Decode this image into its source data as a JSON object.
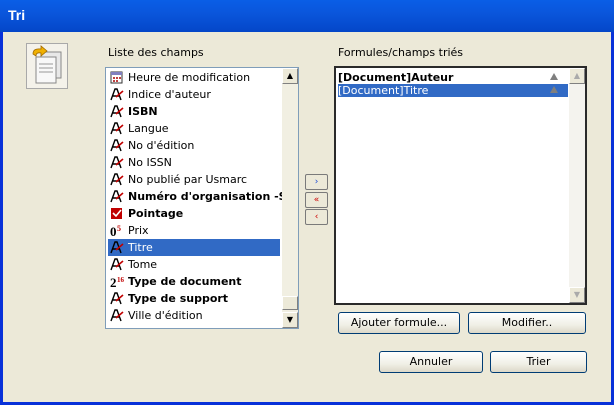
{
  "window": {
    "title": "Tri"
  },
  "fields_list": {
    "label": "Liste des champs",
    "items": [
      {
        "label": "Heure de modification",
        "bold": false,
        "icon": "calendar-icon"
      },
      {
        "label": "Indice d'auteur",
        "bold": false,
        "icon": "text-field-icon"
      },
      {
        "label": "ISBN",
        "bold": true,
        "icon": "text-field-icon"
      },
      {
        "label": "Langue",
        "bold": false,
        "icon": "text-field-icon"
      },
      {
        "label": "No d'édition",
        "bold": false,
        "icon": "text-field-icon"
      },
      {
        "label": "No ISSN",
        "bold": false,
        "icon": "text-field-icon"
      },
      {
        "label": "No publié par Usmarc",
        "bold": false,
        "icon": "text-field-icon"
      },
      {
        "label": "Numéro d'organisation -SD",
        "bold": true,
        "icon": "text-field-icon"
      },
      {
        "label": "Pointage",
        "bold": true,
        "icon": "checkbox-field-icon"
      },
      {
        "label": "Prix",
        "bold": false,
        "icon": "numeric-field-icon"
      },
      {
        "label": "Titre",
        "bold": false,
        "icon": "text-field-icon",
        "selected": true
      },
      {
        "label": "Tome",
        "bold": false,
        "icon": "text-field-icon"
      },
      {
        "label": "Type de document",
        "bold": true,
        "icon": "list-field-icon"
      },
      {
        "label": "Type de support",
        "bold": true,
        "icon": "text-field-icon"
      },
      {
        "label": "Ville d'édition",
        "bold": false,
        "icon": "text-field-icon"
      }
    ]
  },
  "sorted_list": {
    "label": "Formules/champs triés",
    "items": [
      {
        "prefix": "[Document]",
        "label": "Auteur",
        "bold": true
      },
      {
        "prefix": "[Document]",
        "label": "Titre",
        "bold": false,
        "selected": true
      }
    ]
  },
  "move_buttons": {
    "add": "›",
    "remove_all": "«",
    "remove": "‹"
  },
  "buttons": {
    "add_formula": "Ajouter formule...",
    "modify": "Modifier..",
    "cancel": "Annuler",
    "sort": "Trier"
  }
}
